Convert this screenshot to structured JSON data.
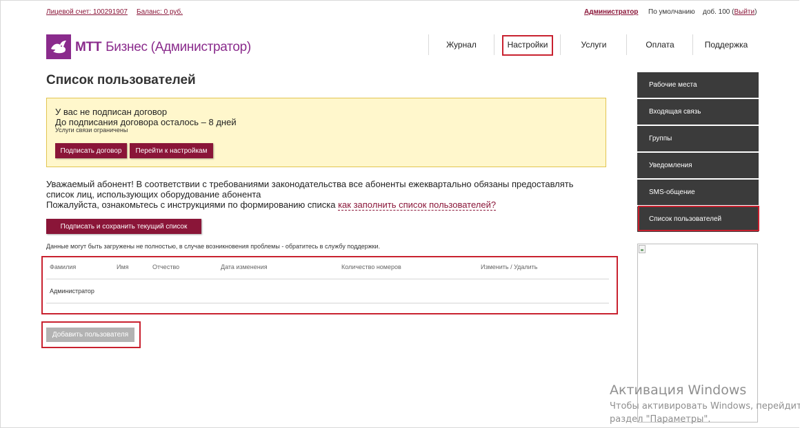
{
  "topbar": {
    "account_label": "Лицевой счет: 100291907",
    "balance_label": "Баланс: 0 руб.",
    "admin_label": "Администратор",
    "default_label": "По умолчанию",
    "ext_label": "доб. 100 (",
    "logout_label": "Выйти",
    "close_paren": ")"
  },
  "logo": {
    "brand": "МТТ",
    "subtitle": "Бизнес (Администратор)",
    "icon": "bird-icon"
  },
  "nav": [
    {
      "label": "Журнал"
    },
    {
      "label": "Настройки"
    },
    {
      "label": "Услуги"
    },
    {
      "label": "Оплата"
    },
    {
      "label": "Поддержка"
    }
  ],
  "page": {
    "title": "Список пользователей"
  },
  "notice": {
    "line1": "У вас не подписан договор",
    "line2": "До подписания договора осталось – 8 дней",
    "line3": "Услуги связи ограничены",
    "sign_button": "Подписать договор",
    "settings_button": "Перейти к настройкам"
  },
  "info": {
    "line1": "Уважаемый абонент! В соответствии с требованиями законодательства все абоненты ежеквартально обязаны предоставлять",
    "line2": "список лиц, использующих оборудование абонента",
    "line3": "Пожалуйста, ознакомьтесь с инструкциями по формированию списка",
    "link": "как заполнить список пользователей?"
  },
  "save_button": "Подписать и сохранить текущий список",
  "small_note": "Данные могут быть загружены не полностью, в случае возникновения проблемы - обратитесь в службу поддержки.",
  "table": {
    "headers": [
      "Фамилия",
      "Имя",
      "Отчество",
      "Дата изменения",
      "Количество номеров",
      "Изменить / Удалить"
    ],
    "rows": [
      [
        "Администратор",
        "",
        "",
        "",
        "",
        ""
      ]
    ]
  },
  "add_user_button": "Добавить пользователя",
  "sidebar": {
    "items": [
      {
        "label": "Рабочие места"
      },
      {
        "label": "Входящая связь"
      },
      {
        "label": "Группы"
      },
      {
        "label": "Уведомления"
      },
      {
        "label": "SMS-общение"
      },
      {
        "label": "Список пользователей"
      }
    ]
  },
  "watermark": {
    "title": "Активация Windows",
    "line1": "Чтобы активировать Windows, перейдите в",
    "line2": "раздел \"Параметры\"."
  },
  "colors": {
    "brand_purple": "#8a2b8c",
    "button_dark": "#8a1538",
    "highlight_red": "#c8202e",
    "sidebar_bg": "#3b3b3b",
    "notice_bg": "#fff7cc"
  }
}
